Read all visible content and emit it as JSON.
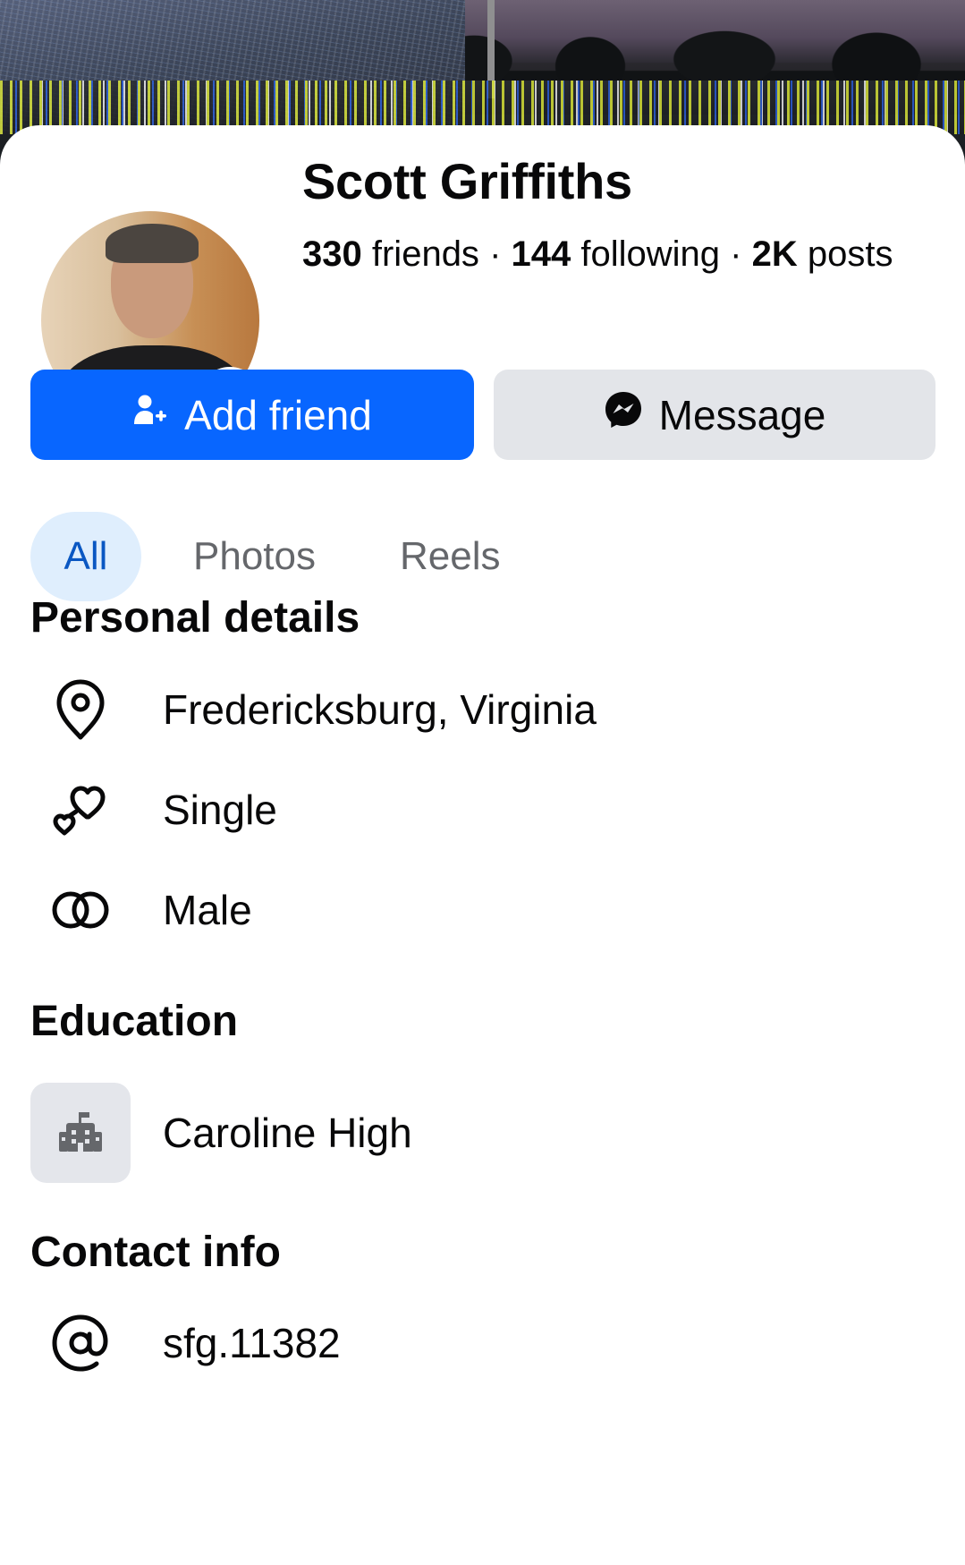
{
  "profile": {
    "name": "Scott Griffiths",
    "friends_count": "330",
    "friends_label": "friends",
    "following_count": "144",
    "following_label": "following",
    "posts_count": "2K",
    "posts_label": "posts",
    "separator": "·",
    "online_status_color": "#2c8a30"
  },
  "actions": {
    "add_friend_label": "Add friend",
    "message_label": "Message",
    "add_friend_icon": "add-person-icon",
    "message_icon": "messenger-icon",
    "primary_color": "#0866ff"
  },
  "tabs": [
    {
      "label": "All",
      "selected": true
    },
    {
      "label": "Photos",
      "selected": false
    },
    {
      "label": "Reels",
      "selected": false
    }
  ],
  "personal_details": {
    "title": "Personal details",
    "items": [
      {
        "icon": "location-pin-icon",
        "text": "Fredericksburg, Virginia"
      },
      {
        "icon": "hearts-icon",
        "text": "Single"
      },
      {
        "icon": "gender-rings-icon",
        "text": "Male"
      }
    ]
  },
  "education": {
    "title": "Education",
    "items": [
      {
        "icon": "school-building-icon",
        "text": "Caroline High"
      }
    ]
  },
  "contact": {
    "title": "Contact info",
    "items": [
      {
        "icon": "at-sign-icon",
        "text": "sfg.11382"
      }
    ]
  }
}
